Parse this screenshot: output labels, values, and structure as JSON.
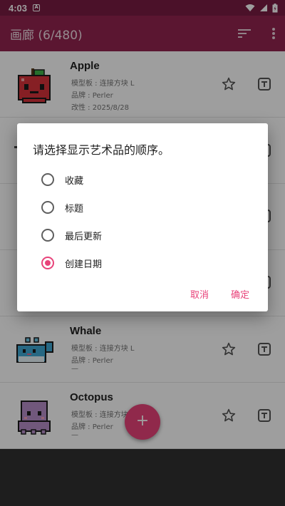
{
  "status": {
    "time": "4:03",
    "notif_glyph": "A"
  },
  "app_bar": {
    "title": "画廊 (6/480)",
    "sort_icon": "sort-icon",
    "more_icon": "more-vert-icon"
  },
  "items": [
    {
      "name": "Apple",
      "board": "模型板 : 连接方块 L",
      "brand": "品牌 : Perler",
      "modified": "改性 : 2025/8/28"
    },
    {
      "name": "Whale",
      "board": "模型板 : 连接方块 L",
      "brand": "品牌 : Perler",
      "modified": "—"
    },
    {
      "name": "Octopus",
      "board": "模型板 : 连接方块 L",
      "brand": "品牌 : Perler",
      "modified": "—"
    }
  ],
  "fab": {
    "label": "+"
  },
  "dialog": {
    "title": "请选择显示艺术品的顺序。",
    "options": [
      "收藏",
      "标题",
      "最后更新",
      "创建日期"
    ],
    "selected_index": 3,
    "cancel": "取消",
    "ok": "确定"
  },
  "colors": {
    "primary": "#93244f",
    "status_bar": "#7a1c43",
    "accent": "#e8437a"
  }
}
